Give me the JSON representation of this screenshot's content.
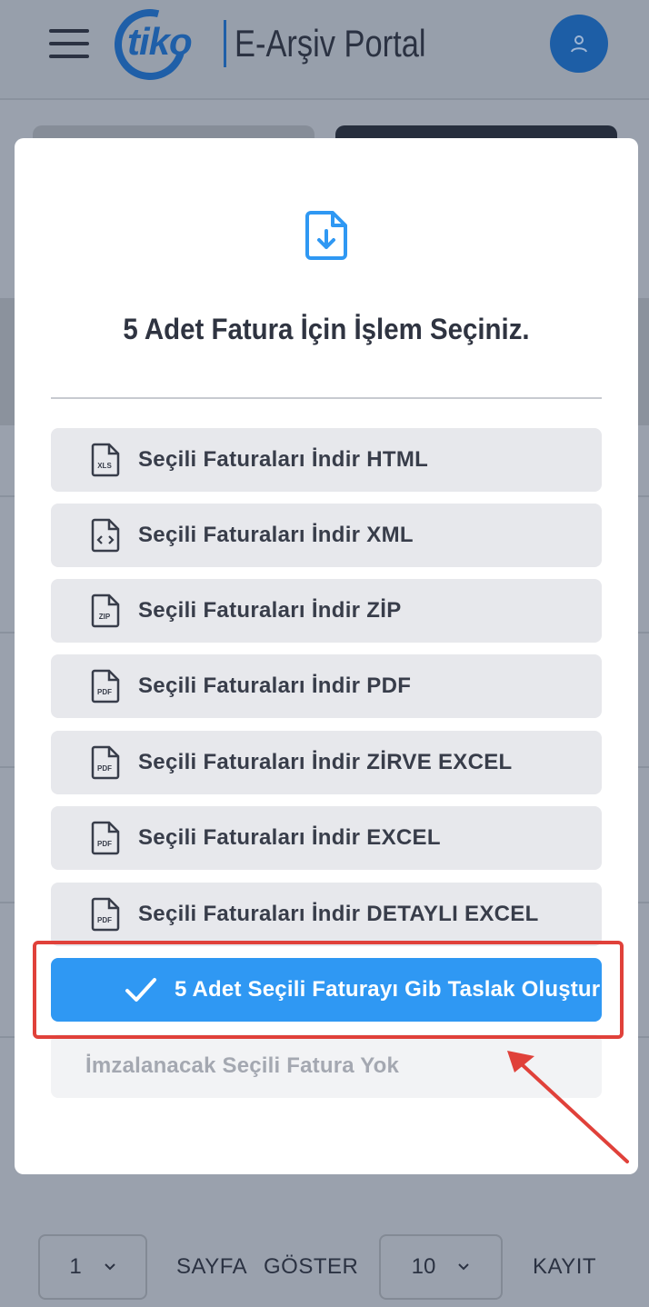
{
  "header": {
    "logo_brand": "tiko",
    "logo_title": "E-Arşiv Portal",
    "menu_icon": "hamburger-icon",
    "user_icon": "user-icon"
  },
  "modal": {
    "icon": "file-download-icon",
    "title": "5 Adet Fatura İçin İşlem Seçiniz.",
    "options": [
      {
        "label": "Seçili Faturaları İndir HTML",
        "icon": "xls-file-icon",
        "badge": "XLS"
      },
      {
        "label": "Seçili Faturaları İndir XML",
        "icon": "code-file-icon",
        "badge": "<>"
      },
      {
        "label": "Seçili Faturaları İndir ZİP",
        "icon": "zip-file-icon",
        "badge": "ZIP"
      },
      {
        "label": "Seçili Faturaları İndir PDF",
        "icon": "pdf-file-icon",
        "badge": "PDF"
      },
      {
        "label": "Seçili Faturaları İndir ZİRVE EXCEL",
        "icon": "pdf-file-icon",
        "badge": "PDF"
      },
      {
        "label": "Seçili Faturaları İndir EXCEL",
        "icon": "pdf-file-icon",
        "badge": "PDF"
      },
      {
        "label": "Seçili Faturaları İndir DETAYLI EXCEL",
        "icon": "pdf-file-icon",
        "badge": "PDF"
      }
    ],
    "primary_action": "5 Adet Seçili Faturayı Gib Taslak Oluştur",
    "disabled_action": "İmzalanacak Seçili Fatura Yok"
  },
  "pager": {
    "page_value": "1",
    "page_label": "SAYFA",
    "show_label": "GÖSTER",
    "count_value": "10",
    "records_label": "KAYIT"
  },
  "colors": {
    "primary": "#2f98f3",
    "highlight": "#e0413a",
    "brand": "#1f5fa8"
  }
}
